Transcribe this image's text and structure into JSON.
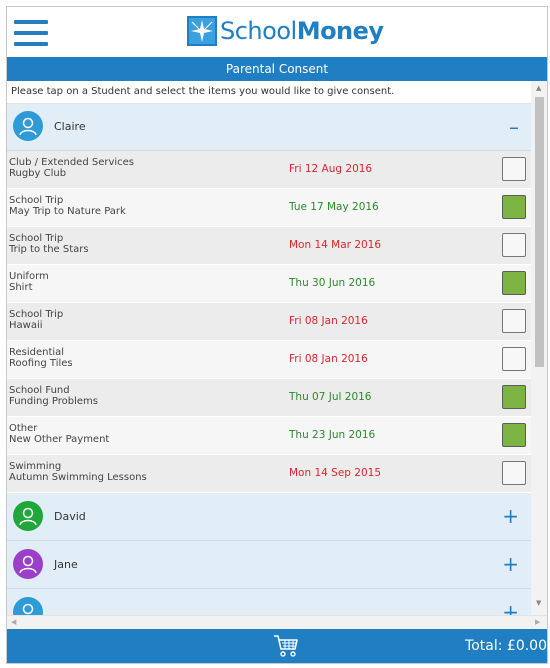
{
  "app": {
    "brand_part1": "School",
    "brand_part2": "Money"
  },
  "title_bar": "Parental Consent",
  "instructions": "Please tap on a Student and select the items you would like to give consent.",
  "students": [
    {
      "name": "Claire",
      "toggle": "–",
      "avatar_color": "#2e9bd6"
    },
    {
      "name": "David",
      "toggle": "+",
      "avatar_color": "#1fa73a"
    },
    {
      "name": "Jane",
      "toggle": "+",
      "avatar_color": "#9b3fc8"
    },
    {
      "name": "",
      "toggle": "+",
      "avatar_color": "#2e9bd6"
    }
  ],
  "items": [
    {
      "category": "Club / Extended Services",
      "name": "Rugby Club",
      "date": "Fri 12 Aug 2016",
      "date_color": "#d9262b",
      "consented": false
    },
    {
      "category": "School Trip",
      "name": "May Trip to Nature Park",
      "date": "Tue 17 May 2016",
      "date_color": "#2c8a2c",
      "consented": true
    },
    {
      "category": "School Trip",
      "name": "Trip to the Stars",
      "date": "Mon 14 Mar 2016",
      "date_color": "#d9262b",
      "consented": false
    },
    {
      "category": "Uniform",
      "name": "Shirt",
      "date": "Thu 30 Jun 2016",
      "date_color": "#2c8a2c",
      "consented": true
    },
    {
      "category": "School Trip",
      "name": "Hawaii",
      "date": "Fri 08 Jan 2016",
      "date_color": "#d9262b",
      "consented": false
    },
    {
      "category": "Residential",
      "name": "Roofing Tiles",
      "date": "Fri 08 Jan 2016",
      "date_color": "#d9262b",
      "consented": false
    },
    {
      "category": "School Fund",
      "name": "Funding Problems",
      "date": "Thu 07 Jul 2016",
      "date_color": "#2c8a2c",
      "consented": true
    },
    {
      "category": "Other",
      "name": "New Other Payment",
      "date": "Thu 23 Jun 2016",
      "date_color": "#2c8a2c",
      "consented": true
    },
    {
      "category": "Swimming",
      "name": "Autumn Swimming Lessons",
      "date": "Mon 14 Sep 2015",
      "date_color": "#d9262b",
      "consented": false
    }
  ],
  "footer": {
    "total": "Total: £0.00"
  },
  "colors": {
    "accent": "#1f7fc2",
    "consent_on": "#7cb342"
  },
  "icons": {
    "menu": "hamburger-icon",
    "cart": "shopping-cart-icon",
    "avatar": "user-icon",
    "logo": "schoolmoney-logo"
  }
}
